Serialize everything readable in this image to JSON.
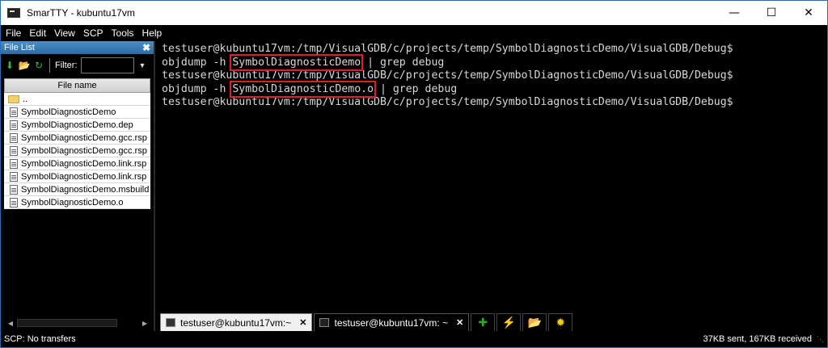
{
  "window": {
    "title": "SmarTTY - kubuntu17vm"
  },
  "menu": [
    "File",
    "Edit",
    "View",
    "SCP",
    "Tools",
    "Help"
  ],
  "file_panel": {
    "title": "File List",
    "filter_label": "Filter:",
    "filter_value": "",
    "column_header": "File name",
    "files": [
      {
        "name": "..",
        "type": "folder"
      },
      {
        "name": "SymbolDiagnosticDemo",
        "type": "file"
      },
      {
        "name": "SymbolDiagnosticDemo.dep",
        "type": "file"
      },
      {
        "name": "SymbolDiagnosticDemo.gcc.rsp",
        "type": "file"
      },
      {
        "name": "SymbolDiagnosticDemo.gcc.rsp",
        "type": "file"
      },
      {
        "name": "SymbolDiagnosticDemo.link.rsp",
        "type": "file"
      },
      {
        "name": "SymbolDiagnosticDemo.link.rsp",
        "type": "file"
      },
      {
        "name": "SymbolDiagnosticDemo.msbuild",
        "type": "file"
      },
      {
        "name": "SymbolDiagnosticDemo.o",
        "type": "file"
      }
    ]
  },
  "terminal": {
    "prompt": "testuser@kubuntu17vm:/tmp/VisualGDB/c/projects/temp/SymbolDiagnosticDemo/VisualGDB/Debug$",
    "lines": [
      {
        "kind": "prompt"
      },
      {
        "kind": "cmd",
        "pre": "objdump -h ",
        "hl": "SymbolDiagnosticDemo",
        "post": " | grep debug"
      },
      {
        "kind": "prompt"
      },
      {
        "kind": "cmd",
        "pre": "objdump -h ",
        "hl": "SymbolDiagnosticDemo.o",
        "post": " | grep debug"
      },
      {
        "kind": "prompt"
      }
    ],
    "highlight_color": "#e02020"
  },
  "tabs": [
    {
      "label": "testuser@kubuntu17vm:~",
      "active": true
    },
    {
      "label": "testuser@kubuntu17vm: ~",
      "active": false
    }
  ],
  "tab_buttons": [
    {
      "icon": "plus-icon",
      "glyph": "✚",
      "color": "#2ea82e"
    },
    {
      "icon": "lightning-icon",
      "glyph": "⚡",
      "color": "#f0c020"
    },
    {
      "icon": "folder-open-icon",
      "glyph": "📂",
      "color": "#f2c14e"
    },
    {
      "icon": "gear-sun-icon",
      "glyph": "✹",
      "color": "#f5d000"
    }
  ],
  "status": {
    "left": "SCP: No transfers",
    "right": "37KB sent, 167KB received"
  }
}
